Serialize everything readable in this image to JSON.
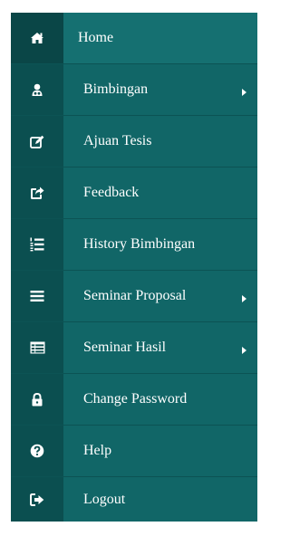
{
  "menu": {
    "items": [
      {
        "label": "Home",
        "icon": "home-icon",
        "submenu": false
      },
      {
        "label": "Bimbingan",
        "icon": "user-group-icon",
        "submenu": true
      },
      {
        "label": "Ajuan Tesis",
        "icon": "edit-icon",
        "submenu": false
      },
      {
        "label": "Feedback",
        "icon": "share-icon",
        "submenu": false
      },
      {
        "label": "History Bimbingan",
        "icon": "list-ordered-icon",
        "submenu": false
      },
      {
        "label": "Seminar Proposal",
        "icon": "bars-icon",
        "submenu": true
      },
      {
        "label": "Seminar Hasil",
        "icon": "table-list-icon",
        "submenu": true
      },
      {
        "label": "Change Password",
        "icon": "lock-icon",
        "submenu": false
      },
      {
        "label": "Help",
        "icon": "question-circle-icon",
        "submenu": false
      },
      {
        "label": "Logout",
        "icon": "sign-out-icon",
        "submenu": false
      }
    ]
  },
  "colors": {
    "item_background": "#116667",
    "icon_cell_background": "#0b4f50",
    "text": "#ffffff"
  }
}
